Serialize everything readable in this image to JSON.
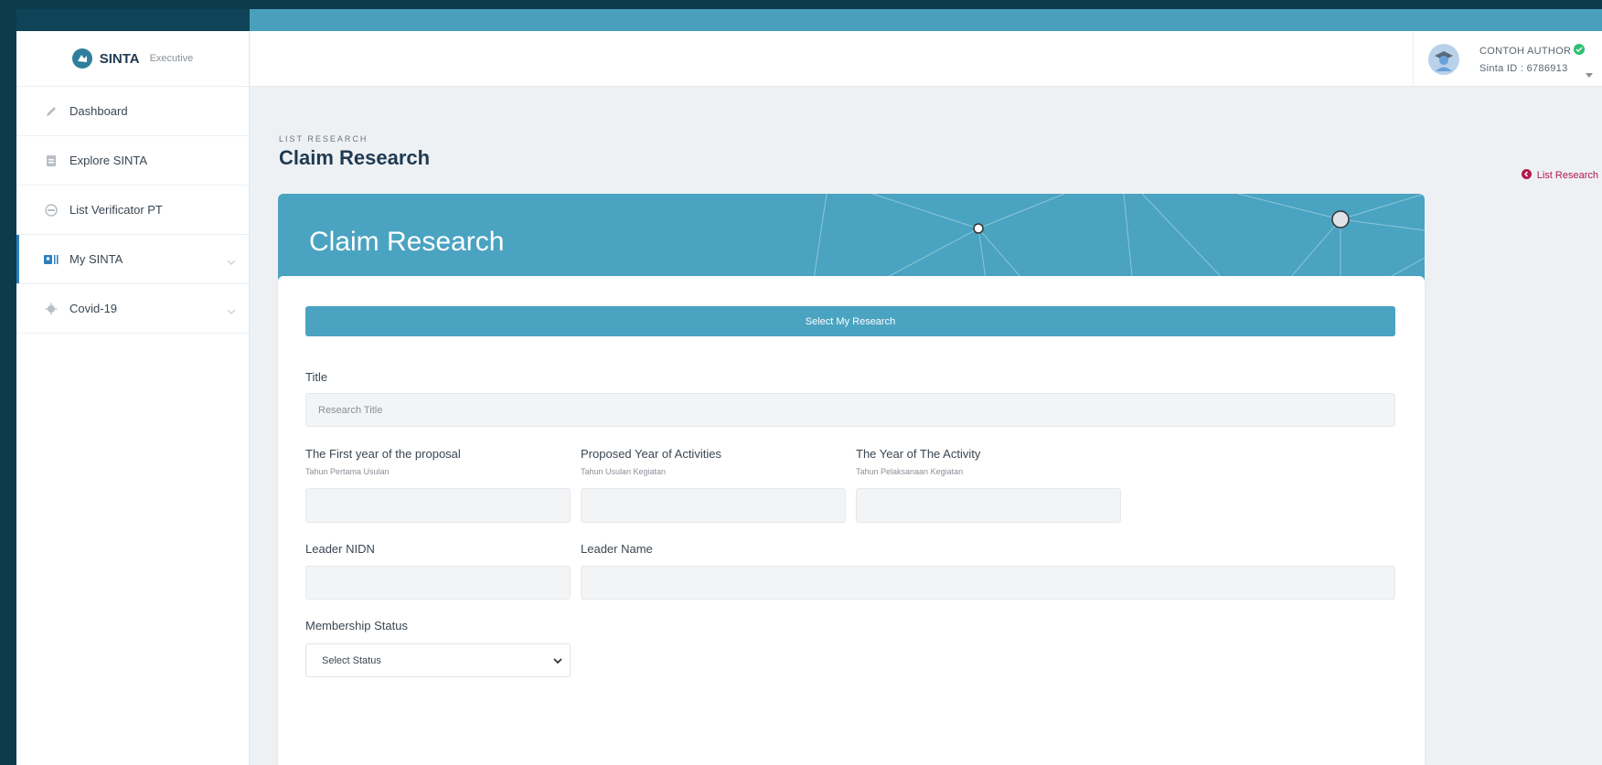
{
  "brand": {
    "name": "SINTA",
    "suffix": "Executive"
  },
  "sidebar": {
    "items": [
      {
        "label": "Dashboard",
        "icon": "pencil-icon"
      },
      {
        "label": "Explore SINTA",
        "icon": "document-icon"
      },
      {
        "label": "List Verificator PT",
        "icon": "user-circle-icon"
      },
      {
        "label": "My SINTA",
        "icon": "id-card-icon",
        "active": true
      },
      {
        "label": "Covid-19",
        "icon": "virus-icon"
      }
    ]
  },
  "user": {
    "name": "CONTOH AUTHOR",
    "sinta_id": "Sinta ID : 6786913"
  },
  "page": {
    "breadcrumb": "LIST RESEARCH",
    "title": "Claim Research",
    "back_link": "List Research"
  },
  "card": {
    "hero_title": "Claim Research",
    "select_button": "Select My Research",
    "fields": {
      "title_label": "Title",
      "title_placeholder": "Research Title",
      "first_year_label": "The First year of the proposal",
      "first_year_sub": "Tahun Pertama Usulan",
      "proposed_year_label": "Proposed Year of Activities",
      "proposed_year_sub": "Tahun Usulan Kegiatan",
      "activity_year_label": "The Year of The Activity",
      "activity_year_sub": "Tahun Pelaksanaan Kegiatan",
      "leader_nidn_label": "Leader NIDN",
      "leader_name_label": "Leader Name",
      "membership_label": "Membership Status",
      "membership_selected": "Select Status"
    }
  },
  "colors": {
    "accent": "#4aa3c1",
    "sidebar_dark": "#0c3b4d",
    "link_red": "#b3184a",
    "active_bar": "#2d7fbd"
  }
}
